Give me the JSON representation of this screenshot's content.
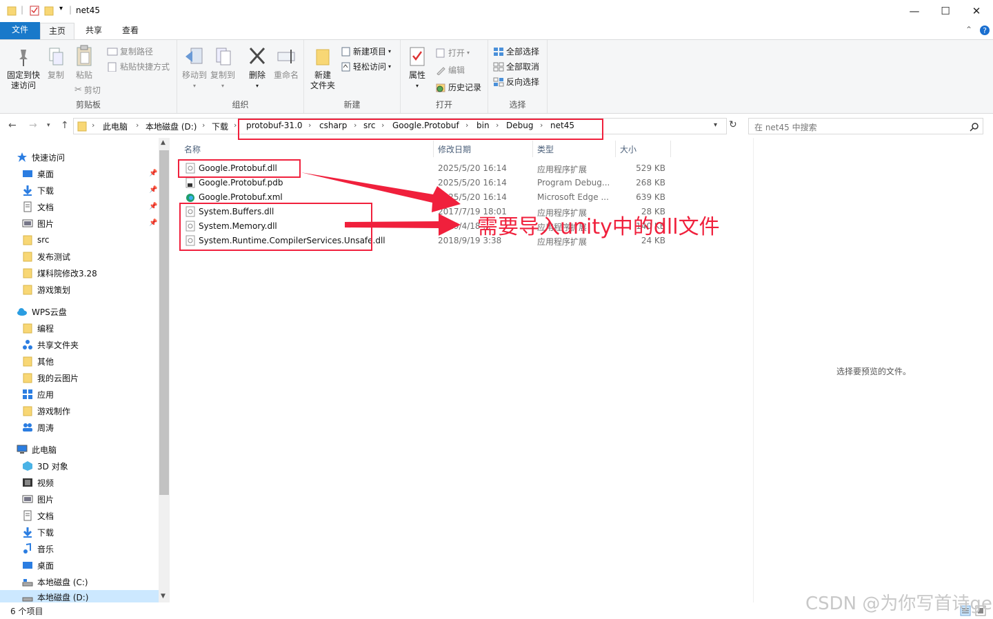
{
  "window": {
    "title": "net45",
    "minimize": "—",
    "maximize": "☐",
    "close": "✕"
  },
  "tabs": {
    "file": "文件",
    "home": "主页",
    "share": "共享",
    "view": "查看"
  },
  "ribbon": {
    "clipboard": {
      "label": "剪贴板",
      "pin": "固定到快\n速访问",
      "copy": "复制",
      "paste": "粘贴",
      "copy_path": "复制路径",
      "paste_shortcut": "粘贴快捷方式",
      "cut": "剪切"
    },
    "organize": {
      "label": "组织",
      "move_to": "移动到",
      "copy_to": "复制到",
      "delete": "删除",
      "rename": "重命名"
    },
    "new": {
      "label": "新建",
      "new_folder": "新建\n文件夹",
      "new_item": "新建项目",
      "easy_access": "轻松访问"
    },
    "open": {
      "label": "打开",
      "properties": "属性",
      "open": "打开",
      "edit": "编辑",
      "history": "历史记录"
    },
    "select": {
      "label": "选择",
      "select_all": "全部选择",
      "select_none": "全部取消",
      "invert": "反向选择"
    }
  },
  "address": {
    "crumbs": [
      "此电脑",
      "本地磁盘 (D:)",
      "下载",
      "protobuf-31.0",
      "csharp",
      "src",
      "Google.Protobuf",
      "bin",
      "Debug",
      "net45"
    ],
    "search_placeholder": "在 net45 中搜索"
  },
  "sidebar": {
    "quick_access": "快速访问",
    "quick_items": [
      "桌面",
      "下载",
      "文档",
      "图片",
      "src",
      "发布测试",
      "煤科院修改3.28",
      "游戏策划"
    ],
    "wps": "WPS云盘",
    "wps_items": [
      "编程",
      "共享文件夹",
      "其他",
      "我的云图片",
      "应用",
      "游戏制作",
      "周涛"
    ],
    "pc": "此电脑",
    "pc_items": [
      "3D 对象",
      "视频",
      "图片",
      "文档",
      "下载",
      "音乐",
      "桌面",
      "本地磁盘 (C:)",
      "本地磁盘 (D:)"
    ]
  },
  "columns": {
    "name": "名称",
    "date": "修改日期",
    "type": "类型",
    "size": "大小"
  },
  "files": [
    {
      "name": "Google.Protobuf.dll",
      "date": "2025/5/20 16:14",
      "type": "应用程序扩展",
      "size": "529 KB",
      "icon": "dll-icon"
    },
    {
      "name": "Google.Protobuf.pdb",
      "date": "2025/5/20 16:14",
      "type": "Program Debug...",
      "size": "268 KB",
      "icon": "pdb-icon"
    },
    {
      "name": "Google.Protobuf.xml",
      "date": "2025/5/20 16:14",
      "type": "Microsoft Edge ...",
      "size": "639 KB",
      "icon": "edge-icon"
    },
    {
      "name": "System.Buffers.dll",
      "date": "2017/7/19 18:01",
      "type": "应用程序扩展",
      "size": "28 KB",
      "icon": "dll-icon"
    },
    {
      "name": "System.Memory.dll",
      "date": "2019/4/18 ...",
      "type": "应用程序扩展",
      "size": "140 KB",
      "icon": "dll-icon"
    },
    {
      "name": "System.Runtime.CompilerServices.Unsafe.dll",
      "date": "2018/9/19 3:38",
      "type": "应用程序扩展",
      "size": "24 KB",
      "icon": "dll-icon"
    }
  ],
  "preview": {
    "text": "选择要预览的文件。"
  },
  "status": {
    "count": "6 个项目"
  },
  "annotation": {
    "text": "需要导入unity中的dll文件",
    "color": "#f0203c"
  },
  "watermark": "CSDN @为你写首诗ge"
}
